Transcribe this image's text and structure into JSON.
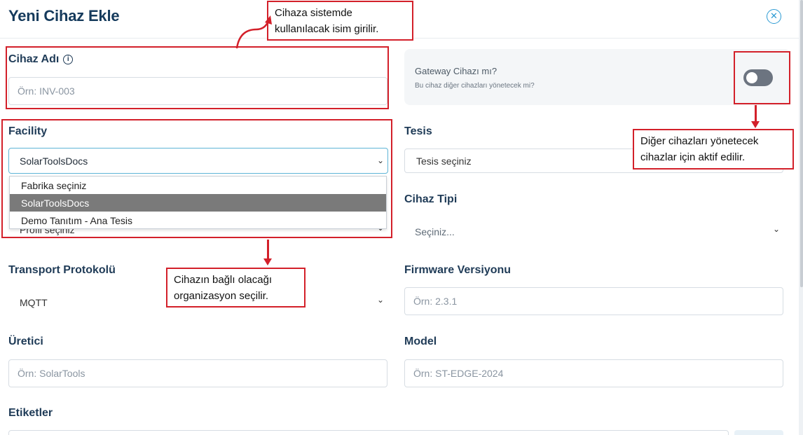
{
  "header": {
    "title": "Yeni Cihaz Ekle",
    "close_icon": "close-circle-icon"
  },
  "cihaz_adi": {
    "label": "Cihaz Adı",
    "info_icon": "info-circle-icon",
    "placeholder": "Örn: INV-003"
  },
  "gateway": {
    "title": "Gateway Cihazı mı?",
    "subtitle": "Bu cihaz diğer cihazları yönetecek mi?",
    "enabled": false
  },
  "facility": {
    "label": "Facility",
    "selected": "SolarToolsDocs",
    "options": [
      "Fabrika seçiniz",
      "SolarToolsDocs",
      "Demo Tanıtım - Ana Tesis"
    ],
    "hidden_value": "Profil seçiniz"
  },
  "tesis": {
    "label": "Tesis",
    "value": "Tesis seçiniz"
  },
  "cihaz_tipi": {
    "label": "Cihaz Tipi",
    "value": "Seçiniz..."
  },
  "transport": {
    "label": "Transport Protokolü",
    "value": "MQTT"
  },
  "firmware": {
    "label": "Firmware Versiyonu",
    "placeholder": "Örn: 2.3.1"
  },
  "uretici": {
    "label": "Üretici",
    "placeholder": "Örn: SolarTools"
  },
  "model": {
    "label": "Model",
    "placeholder": "Örn: ST-EDGE-2024"
  },
  "etiketler": {
    "label": "Etiketler"
  },
  "annotations": {
    "name_note": "Cihaza sistemde kullanılacak isim girilir.",
    "gateway_note": "Diğer cihazları yönetecek cihazlar için aktif edilir.",
    "facility_note": "Cihazın bağlı olacağı organizasyon seçilir."
  },
  "colors": {
    "accent": "#5eb4d6",
    "annotation_red": "#d3202a",
    "heading": "#153a5c"
  }
}
